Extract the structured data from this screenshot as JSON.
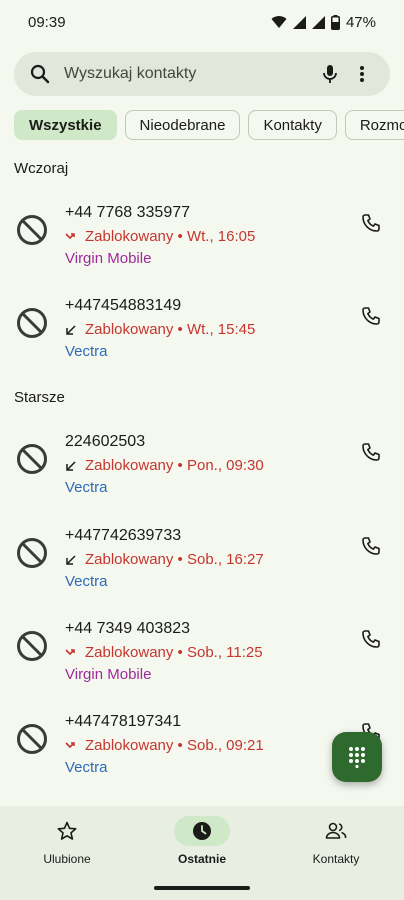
{
  "status_bar": {
    "time": "09:39",
    "battery": "47%"
  },
  "search": {
    "placeholder": "Wyszukaj kontakty"
  },
  "chips": [
    {
      "label": "Wszystkie",
      "selected": true
    },
    {
      "label": "Nieodebrane"
    },
    {
      "label": "Kontakty"
    },
    {
      "label": "Rozmo"
    }
  ],
  "sections": [
    {
      "title": "Wczoraj"
    },
    {
      "title": "Starsze"
    }
  ],
  "calls": [
    {
      "number": "+44 7768 335977",
      "direction": "missed-icon",
      "status": "Zablokowany • Wt., 16:05",
      "carrier": "Virgin Mobile",
      "carrier_color": "#a02a9a"
    },
    {
      "number": "+447454883149",
      "direction": "incoming-icon",
      "status": "Zablokowany • Wt., 15:45",
      "carrier": "Vectra",
      "carrier_color": "#2e6ab8"
    },
    {
      "number": "224602503",
      "direction": "incoming-icon",
      "status": "Zablokowany • Pon., 09:30",
      "carrier": "Vectra",
      "carrier_color": "#2e6ab8"
    },
    {
      "number": "+447742639733",
      "direction": "incoming-icon",
      "status": "Zablokowany • Sob., 16:27",
      "carrier": "Vectra",
      "carrier_color": "#2e6ab8"
    },
    {
      "number": "+44 7349 403823",
      "direction": "missed-icon",
      "status": "Zablokowany • Sob., 11:25",
      "carrier": "Virgin Mobile",
      "carrier_color": "#a02a9a"
    },
    {
      "number": "+447478197341",
      "direction": "missed-icon",
      "status": "Zablokowany • Sob., 09:21",
      "carrier": "Vectra",
      "carrier_color": "#2e6ab8"
    }
  ],
  "bottom_nav": [
    {
      "label": "Ulubione",
      "icon": "star-icon"
    },
    {
      "label": "Ostatnie",
      "icon": "clock-icon",
      "active": true
    },
    {
      "label": "Kontakty",
      "icon": "people-icon"
    }
  ],
  "colors": {
    "accent": "#2e6a2e",
    "blocked": "#c5362f",
    "selected_chip": "#cfe8c8",
    "background": "#f4f8ef"
  }
}
